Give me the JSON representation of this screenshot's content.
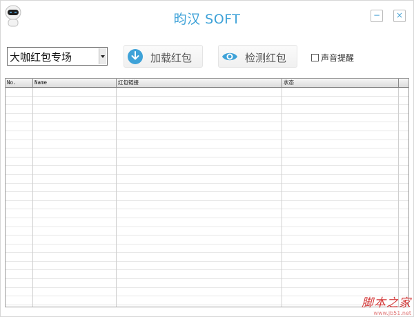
{
  "window": {
    "title": "昀汉 SOFT",
    "minimize_label": "−",
    "close_label": "×"
  },
  "toolbar": {
    "category_value": "大咖红包专场",
    "load_label": "加载红包",
    "detect_label": "检测红包",
    "sound_label": "声音提醒",
    "sound_checked": false
  },
  "table": {
    "headers": [
      "No.",
      "Name",
      "红包链接",
      "状态"
    ]
  },
  "watermark": {
    "main": "脚本之家",
    "sub": "www.jb51.net"
  },
  "colors": {
    "accent": "#3ea2d8"
  }
}
